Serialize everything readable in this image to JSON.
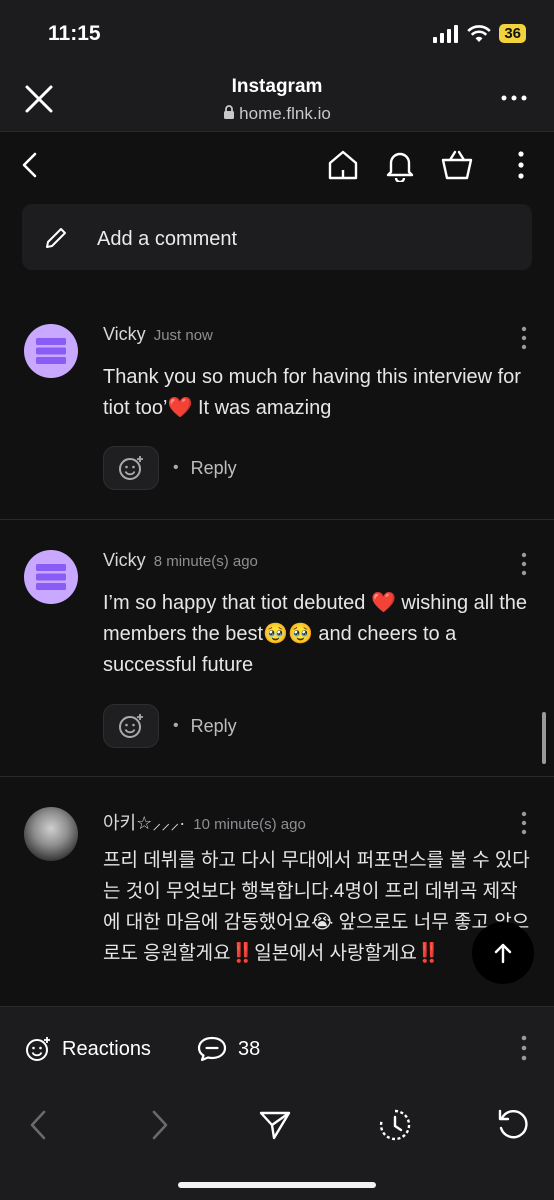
{
  "status": {
    "time": "11:15",
    "battery": "36"
  },
  "browser": {
    "title": "Instagram",
    "url": "home.flnk.io"
  },
  "add_comment": {
    "label": "Add a comment"
  },
  "comments": [
    {
      "name": "Vicky",
      "time": "Just now",
      "text": "Thank you so much for having this interview for tiot too’❤️ It was amazing",
      "reply": "Reply"
    },
    {
      "name": "Vicky",
      "time": "8 minute(s) ago",
      "text": "I’m so happy that tiot debuted ❤️ wishing all the members the best🥹🥹 and cheers to a successful future",
      "reply": "Reply"
    },
    {
      "name": "아키☆⸝⸝⸝·",
      "time": "10 minute(s) ago",
      "text": "프리 데뷔를 하고 다시 무대에서 퍼포먼스를 볼 수 있다는 것이 무엇보다 행복합니다.4명이 프리 데뷔곡 제작에 대한 마음에 감동했어요😭 앞으로도 너무 좋고 앞으로도 응원할게요‼️일본에서 사랑할게요‼️"
    }
  ],
  "reactions_bar": {
    "reactions_label": "Reactions",
    "comment_count": "38"
  },
  "colors": {
    "background": "#111111",
    "avatar": "#c9a8ff",
    "avatar_icon": "#8a5cf6",
    "bar": "#1c1c1e"
  }
}
